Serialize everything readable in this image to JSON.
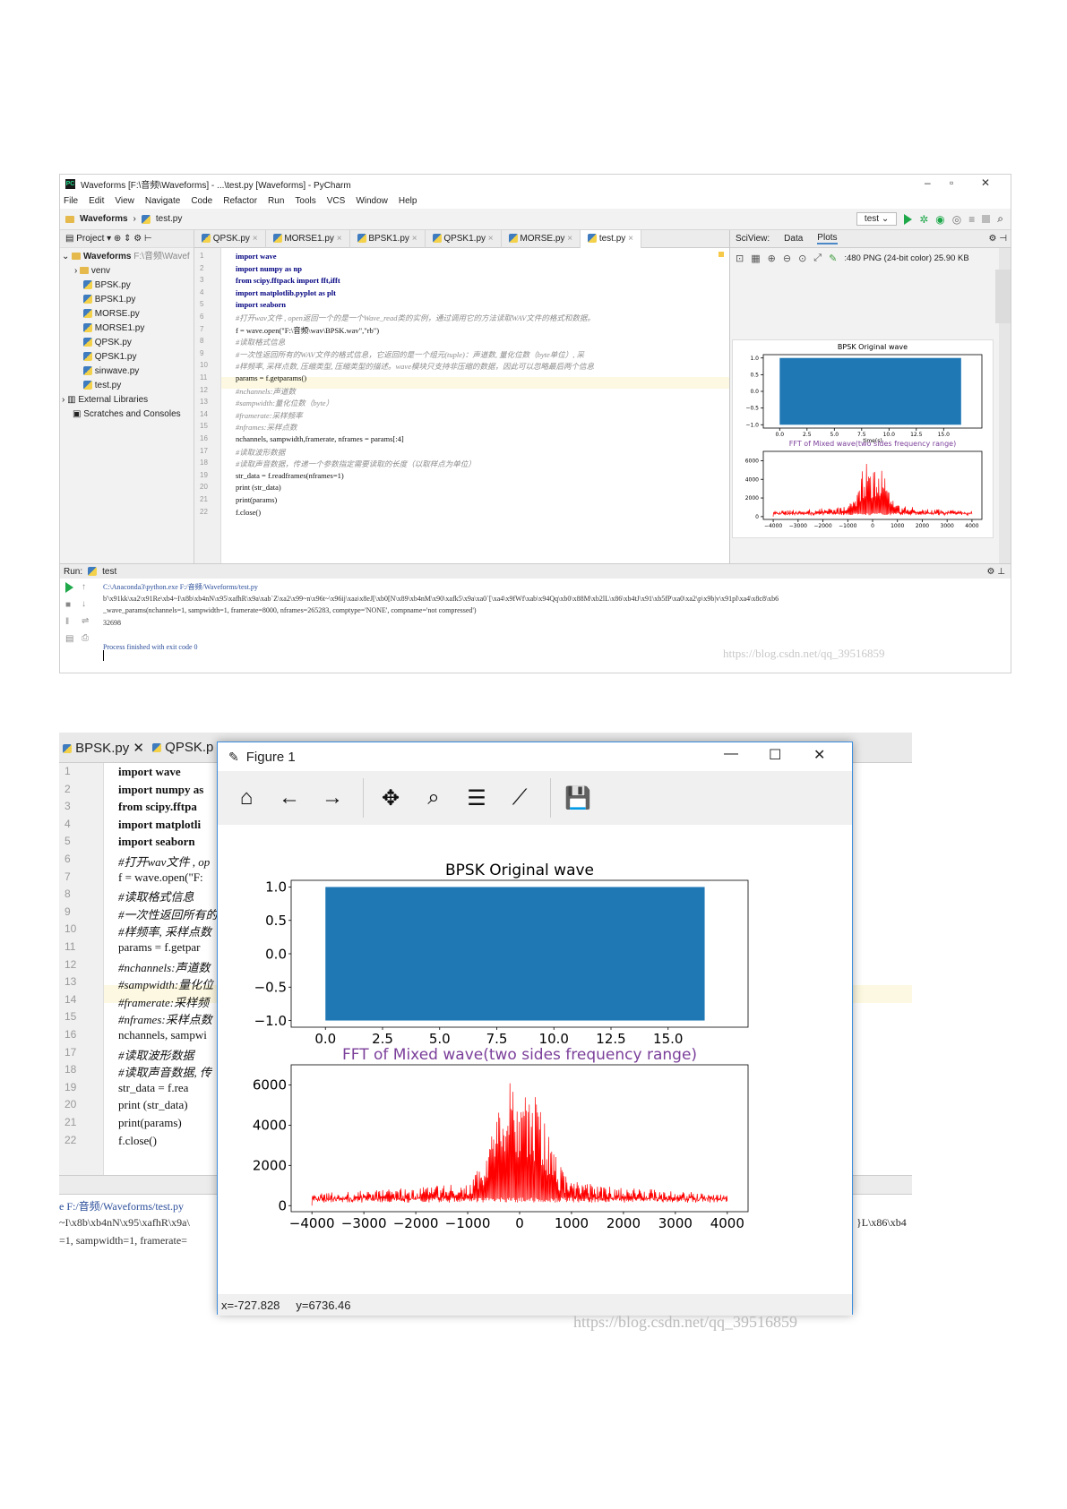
{
  "ide": {
    "title": "Waveforms [F:\\音频\\Waveforms] - ...\\test.py [Waveforms] - PyCharm",
    "menu": [
      "File",
      "Edit",
      "View",
      "Navigate",
      "Code",
      "Refactor",
      "Run",
      "Tools",
      "VCS",
      "Window",
      "Help"
    ],
    "breadcrumb": [
      "Waveforms",
      "test.py"
    ],
    "run_config": "test",
    "project_label": "Project",
    "project_tree": {
      "root": "Waveforms",
      "root_path": "F:\\音频\\Wavef",
      "items": [
        "venv",
        "BPSK.py",
        "BPSK1.py",
        "MORSE.py",
        "MORSE1.py",
        "QPSK.py",
        "QPSK1.py",
        "sinwave.py",
        "test.py"
      ],
      "external": "External Libraries",
      "scratches": "Scratches and Consoles"
    },
    "tabs": [
      "QPSK.py",
      "MORSE1.py",
      "BPSK1.py",
      "QPSK1.py",
      "MORSE.py",
      "test.py"
    ],
    "code_lines": [
      "import wave",
      "import numpy as np",
      "from scipy.fftpack import fft,ifft",
      "import matplotlib.pyplot as plt",
      "import seaborn",
      "#打开wav文件 , open返回一个的是一个Wave_read类的实例，通过调用它的方法读取WAV文件的格式和数据。",
      "f = wave.open(\"F:\\音频\\wav\\BPSK.wav\",\"rb\")",
      "#读取格式信息",
      "#一次性返回所有的WAV文件的格式信息，它返回的是一个组元(tuple)：声道数, 量化位数（byte单位）, 采",
      "#样频率, 采样点数, 压缩类型, 压缩类型的描述。wave模块只支持非压缩的数据，因此可以忽略最后两个信息",
      "params = f.getparams()",
      "#nchannels:声道数",
      "#sampwidth:量化位数（byte）",
      "#framerate:采样频率",
      "#nframes:采样点数",
      "nchannels, sampwidth,framerate, nframes = params[:4]",
      "#读取波形数据",
      "#读取声音数据，传递一个参数指定需要读取的长度（以取样点为单位）",
      "str_data  = f.readframes(nframes=1)",
      "print (str_data)",
      "print(params)",
      "f.close()"
    ],
    "sciview": {
      "tabs": [
        "SciView:",
        "Data",
        "Plots"
      ],
      "image_info": ":480 PNG (24-bit color) 25.90 KB"
    },
    "run": {
      "label": "Run:",
      "config": "test",
      "lines": [
        "C:\\Anaconda3\\python.exe F:/音频/Waveforms/test.py",
        "b'\\x91kk\\xa2\\x91Re\\xb4~I\\x8b\\xb4nN\\x95\\xafhR\\x9a\\xab`Z\\xa2\\x99~n\\x96t~\\x96ij\\xaa\\x8eJ[\\xb0[N\\x89\\xb4nM\\x90\\xafk5\\x9a\\xa0`[\\xa4\\x9fWf\\xab\\x94Qq\\xb0\\x88M\\xb2lL\\x86\\xb4tJ\\x91\\xb5fP\\xa0\\xa2\\p\\x9b|v\\x91pl\\xa4\\x8c8\\xb6",
        "_wave_params(nchannels=1, sampwidth=1, framerate=8000, nframes=265283, comptype='NONE', compname='not compressed')",
        "32698",
        "",
        "Process finished with exit code 0"
      ]
    },
    "watermark": "https://blog.csdn.net/qq_39516859"
  },
  "figure": {
    "title": "Figure 1",
    "status_x": "x=-727.828",
    "status_y": "y=6736.46",
    "watermark": "https://blog.csdn.net/qq_39516859",
    "bg_tabs": [
      "BPSK.py",
      "QPSK.p"
    ],
    "bg_lines": [
      "import wave",
      "import numpy as",
      "from scipy.fftpa",
      "import matplotli",
      "import seaborn",
      "#打开wav文件 , op",
      "f = wave.open(\"F:",
      "#读取格式信息",
      "#一次性返回所有的",
      "#样频率, 采样点数",
      "params = f.getpar",
      "#nchannels:声道数",
      "#sampwidth:量化位",
      "#framerate:采样频",
      "#nframes:采样点数",
      "nchannels, sampwi",
      "#读取波形数据",
      "#读取声音数据, 传",
      "str_data  = f.rea",
      "print (str_data)",
      "print(params)",
      "f.close()"
    ],
    "bg_console": [
      "e F:/音频/Waveforms/test.py",
      "~I\\x8b\\xb4nN\\x95\\xafhR\\x9a\\",
      "=1, sampwidth=1, framerate="
    ],
    "bg_console_right": "}L\\x86\\xb4"
  },
  "chart_data": [
    {
      "type": "line",
      "title": "BPSK Original wave",
      "xlabel": "time(s)",
      "ylabel": "",
      "xticks": [
        "0.0",
        "2.5",
        "5.0",
        "7.5",
        "10.0",
        "12.5",
        "15.0"
      ],
      "yticks": [
        "1.0",
        "0.5",
        "0.0",
        "−0.5",
        "−1.0"
      ],
      "xlim": [
        -1.5,
        18.5
      ],
      "ylim": [
        -1.1,
        1.1
      ],
      "series": [
        {
          "color": "#1f77b4",
          "x_range": [
            0,
            16.6
          ],
          "y_range": [
            -1.0,
            1.0
          ]
        }
      ],
      "grid": false
    },
    {
      "type": "line",
      "title": "FFT of Mixed wave(two sides frequency range)",
      "title_color": "#7b3f9a",
      "xlabel": "",
      "ylabel": "",
      "xticks": [
        "−4000",
        "−3000",
        "−2000",
        "−1000",
        "0",
        "1000",
        "2000",
        "3000",
        "4000"
      ],
      "yticks": [
        "6000",
        "4000",
        "2000",
        "0"
      ],
      "xlim": [
        -4400,
        4400
      ],
      "ylim": [
        -300,
        7000
      ],
      "series": [
        {
          "color": "#ff0000",
          "x": [
            -4000,
            -3000,
            -2000,
            -1000,
            -800,
            -600,
            -400,
            -200,
            0,
            200,
            400,
            600,
            800,
            1000,
            2000,
            3000,
            4000
          ],
          "envelope": [
            600,
            750,
            900,
            1100,
            1800,
            2800,
            5000,
            6400,
            5200,
            6300,
            5100,
            3000,
            1900,
            1200,
            900,
            750,
            600
          ]
        }
      ],
      "grid": false
    }
  ]
}
